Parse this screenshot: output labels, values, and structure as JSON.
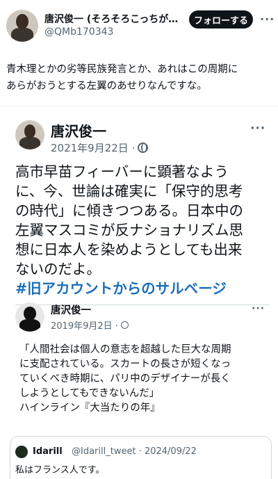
{
  "header": {
    "author_name": "唐沢俊一 (そろそろこっちが…",
    "handle": "@QMb170343",
    "follow_label": "フォローする",
    "more_icon": "more-dots-icon"
  },
  "tweet": {
    "text_line1": "青木理とかの劣等民族発言とか、あれはこの周期に",
    "text_line2": "あらがおうとする左翼のあせりなんですな。"
  },
  "embedded_post": {
    "author_name": "唐沢俊一",
    "date": "2021年9月22日 ·",
    "globe_icon": "globe-icon",
    "lines": [
      "高市早苗フィーバーに顕著なよう",
      "に、今、世論は確実に「保守的思考",
      "の時代」に傾きつつある。日本中の",
      "左翼マスコミが反ナショナリズム思",
      "想に日本人を染めようとしても出来",
      "ないのだよ。"
    ],
    "hashtag": "#旧アカウントからのサルベージ"
  },
  "quoted_post": {
    "author_name": "唐沢俊一",
    "date": "2019年9月2日 ·",
    "lines": [
      "「人間社会は個人の意志を超越した巨大な周期",
      "に支配されている。スカートの長さが短くなっ",
      "ていくべき時期に、パリ中のデザイナーが長く",
      "しようとしてもできないんだ」",
      "ハインライン『大当たりの年』"
    ]
  },
  "reply": {
    "name": "Idarill",
    "handle_date": "@Idarill_tweet · 2024/09/22",
    "text": "私はフランス人です。"
  }
}
